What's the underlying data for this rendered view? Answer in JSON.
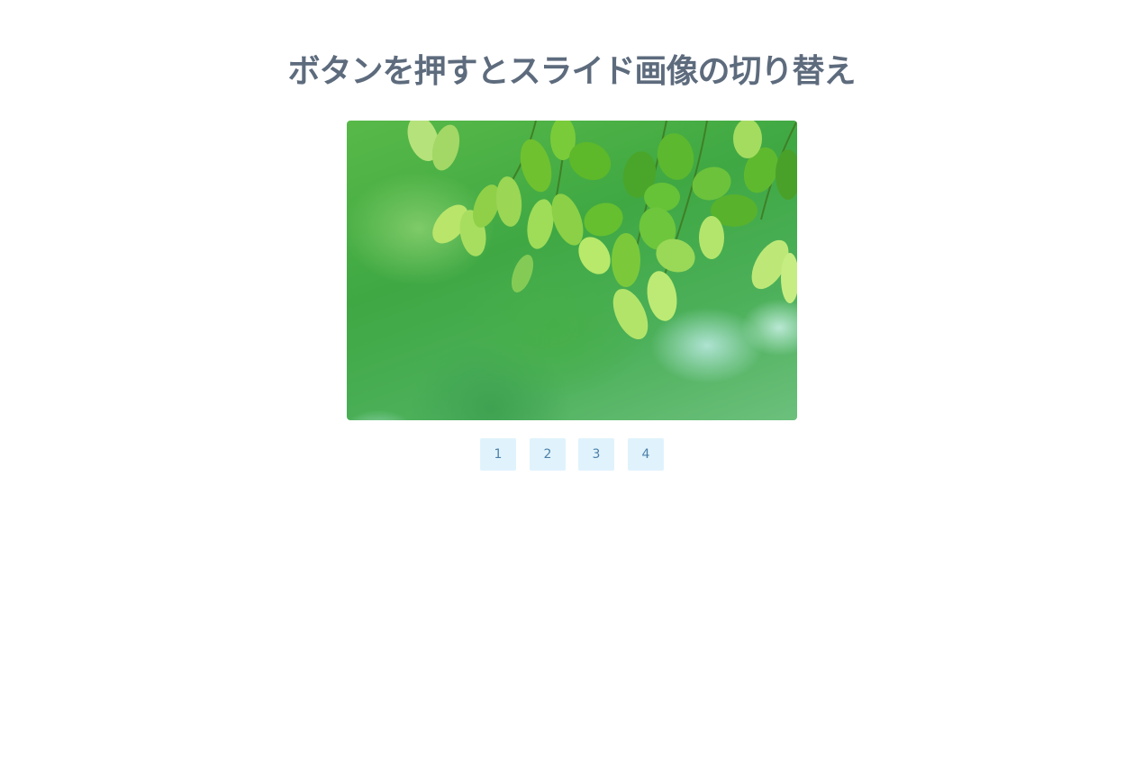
{
  "header": {
    "title": "ボタンを押すとスライド画像の切り替え"
  },
  "slider": {
    "current_slide": 1,
    "image_description_icon": "green-leaves-image"
  },
  "pager": {
    "buttons": [
      {
        "label": "1"
      },
      {
        "label": "2"
      },
      {
        "label": "3"
      },
      {
        "label": "4"
      }
    ]
  },
  "colors": {
    "title": "#5d6b7d",
    "button_bg": "#e0f3fd",
    "button_text": "#4d7fa7"
  }
}
